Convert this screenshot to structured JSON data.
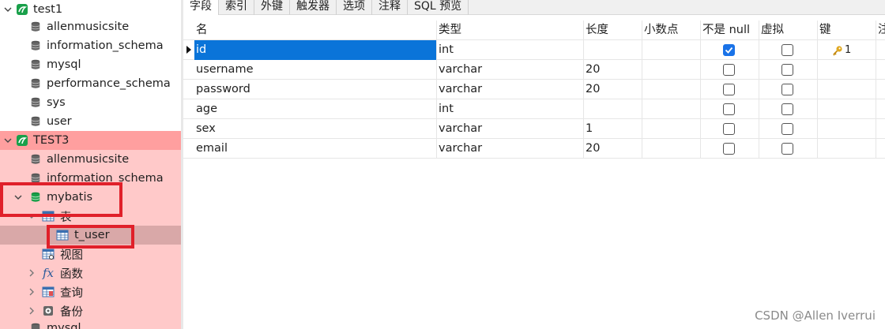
{
  "colors": {
    "connection_green": "#19a04a",
    "selected_row_blue": "#0a74d9",
    "highlight_pink": "#ffc9c9",
    "annotation_red": "#e0202a"
  },
  "sidebar": {
    "connections": [
      {
        "name": "test1",
        "databases": [
          "allenmusicsite",
          "information_schema",
          "mysql",
          "performance_schema",
          "sys",
          "user"
        ]
      },
      {
        "name": "TEST3",
        "databases_before": [
          "allenmusicsite",
          "information_schema"
        ],
        "open_database": {
          "name": "mybatis",
          "folders": {
            "tables": "表",
            "views": "视图",
            "functions": "函数",
            "queries": "查询",
            "backups": "备份"
          },
          "tables": [
            "t_user"
          ]
        },
        "databases_after": [
          "mysql"
        ]
      }
    ]
  },
  "tabs": [
    "字段",
    "索引",
    "外键",
    "触发器",
    "选项",
    "注释",
    "SQL 预览"
  ],
  "grid": {
    "columns": [
      "名",
      "类型",
      "长度",
      "小数点",
      "不是 null",
      "虚拟",
      "键",
      "注"
    ],
    "rows": [
      {
        "name": "id",
        "type": "int",
        "length": "",
        "decimals": "",
        "not_null": true,
        "virtual": false,
        "key": "1"
      },
      {
        "name": "username",
        "type": "varchar",
        "length": "20",
        "decimals": "",
        "not_null": false,
        "virtual": false,
        "key": ""
      },
      {
        "name": "password",
        "type": "varchar",
        "length": "20",
        "decimals": "",
        "not_null": false,
        "virtual": false,
        "key": ""
      },
      {
        "name": "age",
        "type": "int",
        "length": "",
        "decimals": "",
        "not_null": false,
        "virtual": false,
        "key": ""
      },
      {
        "name": "sex",
        "type": "varchar",
        "length": "1",
        "decimals": "",
        "not_null": false,
        "virtual": false,
        "key": ""
      },
      {
        "name": "email",
        "type": "varchar",
        "length": "20",
        "decimals": "",
        "not_null": false,
        "virtual": false,
        "key": ""
      }
    ]
  },
  "watermark": "CSDN @Allen Iverrui"
}
